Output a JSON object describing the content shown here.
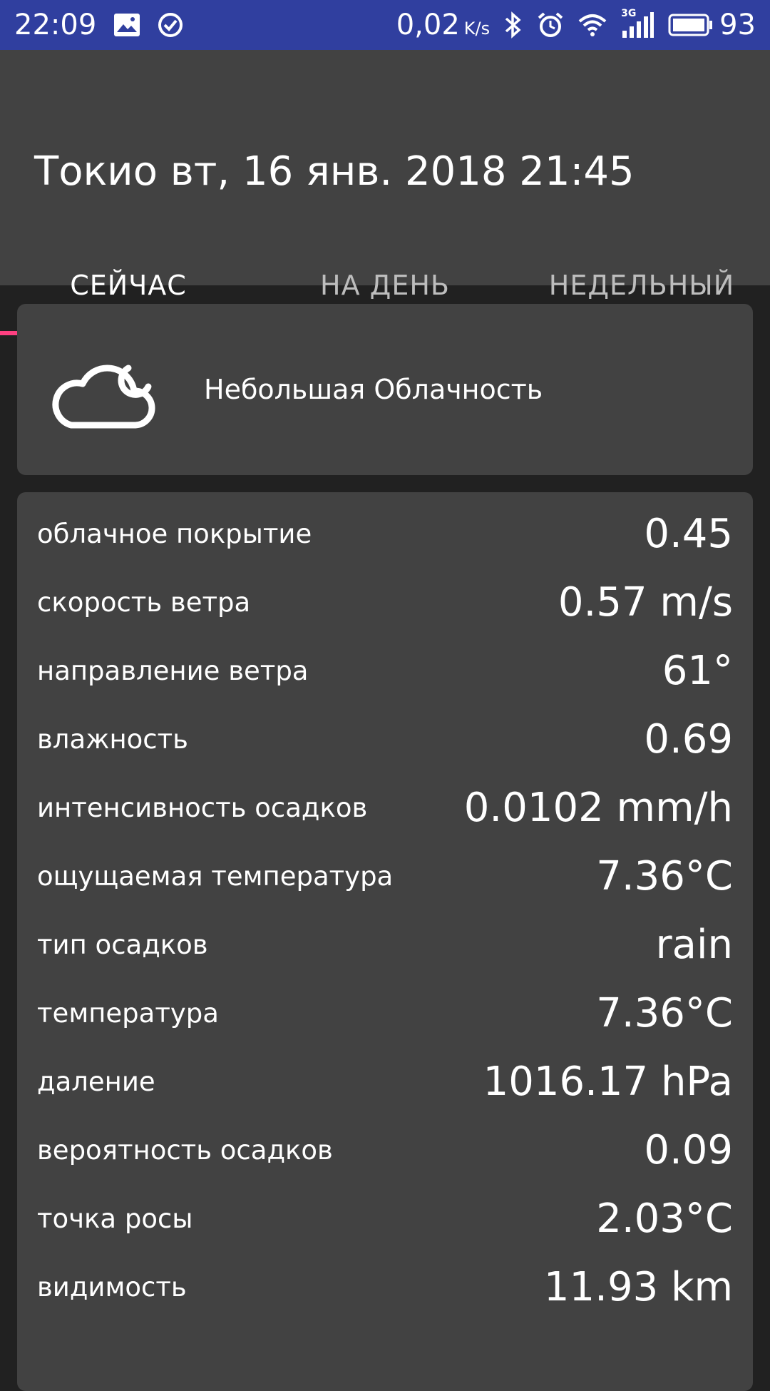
{
  "status_bar": {
    "time": "22:09",
    "speed_value": "0,02",
    "speed_unit": "K/s",
    "network_tag": "3G",
    "battery": "93",
    "icons": [
      "image-icon",
      "check-circle-icon",
      "bluetooth-icon",
      "alarm-icon",
      "wifi-icon",
      "signal-icon",
      "battery-icon"
    ],
    "color": "#303f9f"
  },
  "header": {
    "title": "Токио вт, 16 янв. 2018 21:45"
  },
  "tabs": [
    {
      "label": "СЕЙЧАС",
      "active": true
    },
    {
      "label": "НА ДЕНЬ",
      "active": false
    },
    {
      "label": "НЕДЕЛЬНЫЙ",
      "active": false
    }
  ],
  "accent_color": "#ff4081",
  "summary": {
    "icon": "cloud-moon-icon",
    "text": "Небольшая Облачность"
  },
  "details": [
    {
      "label": "облачное покрытие",
      "value": "0.45"
    },
    {
      "label": "скорость ветра",
      "value": "0.57 m/s"
    },
    {
      "label": "направление ветра",
      "value": "61°"
    },
    {
      "label": "влажность",
      "value": "0.69"
    },
    {
      "label": "интенсивность осадков",
      "value": "0.0102 mm/h"
    },
    {
      "label": "ощущаемая температура",
      "value": "7.36°C"
    },
    {
      "label": "тип осадков",
      "value": "rain"
    },
    {
      "label": "температура",
      "value": "7.36°C"
    },
    {
      "label": "даление",
      "value": "1016.17 hPa"
    },
    {
      "label": "вероятность осадков",
      "value": "0.09"
    },
    {
      "label": "точка росы",
      "value": "2.03°C"
    },
    {
      "label": "видимость",
      "value": "11.93 km"
    }
  ]
}
